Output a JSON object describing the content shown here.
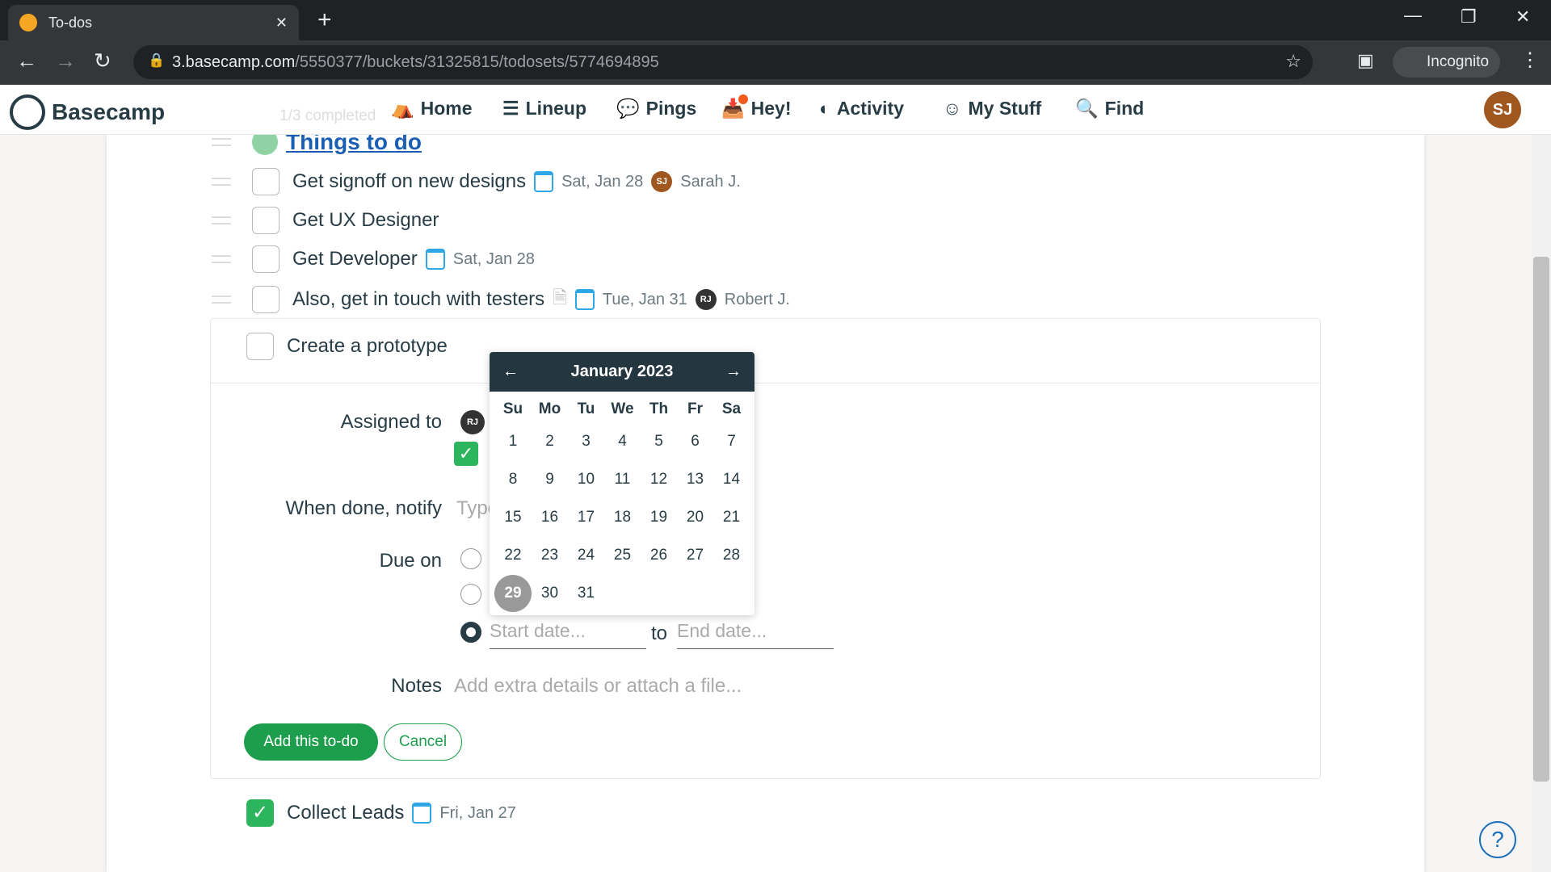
{
  "browser": {
    "tab_title": "To-dos",
    "url_host": "3.basecamp.com",
    "url_path": "/5550377/buckets/31325815/todosets/5774694895",
    "profile": "Incognito"
  },
  "nav": {
    "logo": "Basecamp",
    "items": [
      "Home",
      "Lineup",
      "Pings",
      "Hey!",
      "Activity",
      "My Stuff",
      "Find"
    ],
    "avatar": "SJ"
  },
  "list": {
    "faded_header": "1/3 completed",
    "title": "Things to do",
    "items": [
      {
        "text": "Get signoff on new designs",
        "date": "Sat, Jan 28",
        "assignee_initials": "SJ",
        "assignee": "Sarah J."
      },
      {
        "text": "Get UX Designer"
      },
      {
        "text": "Get Developer",
        "date": "Sat, Jan 28"
      },
      {
        "text": "Also, get in touch with testers",
        "date": "Tue, Jan 31",
        "assignee_initials": "RJ",
        "assignee": "Robert J."
      }
    ]
  },
  "form": {
    "title_value": "Create a prototype",
    "assigned_label": "Assigned to",
    "assigned_initials": "RJ",
    "notify_label": "When done, notify",
    "notify_placeholder": "Type",
    "due_label": "Due on",
    "start_placeholder": "Start date...",
    "to": "to",
    "end_placeholder": "End date...",
    "notes_label": "Notes",
    "notes_placeholder": "Add extra details or attach a file...",
    "submit": "Add this to-do",
    "cancel": "Cancel"
  },
  "calendar": {
    "month": "January 2023",
    "prev": "←",
    "next": "→",
    "weekdays": [
      "Su",
      "Mo",
      "Tu",
      "We",
      "Th",
      "Fr",
      "Sa"
    ],
    "days": [
      "1",
      "2",
      "3",
      "4",
      "5",
      "6",
      "7",
      "8",
      "9",
      "10",
      "11",
      "12",
      "13",
      "14",
      "15",
      "16",
      "17",
      "18",
      "19",
      "20",
      "21",
      "22",
      "23",
      "24",
      "25",
      "26",
      "27",
      "28",
      "29",
      "30",
      "31"
    ],
    "today": "29"
  },
  "completed": {
    "text": "Collect Leads",
    "date": "Fri, Jan 27"
  },
  "colors": {
    "accent": "#1d9e4d",
    "link": "#1a5fb4",
    "calendar_header": "#243740"
  }
}
